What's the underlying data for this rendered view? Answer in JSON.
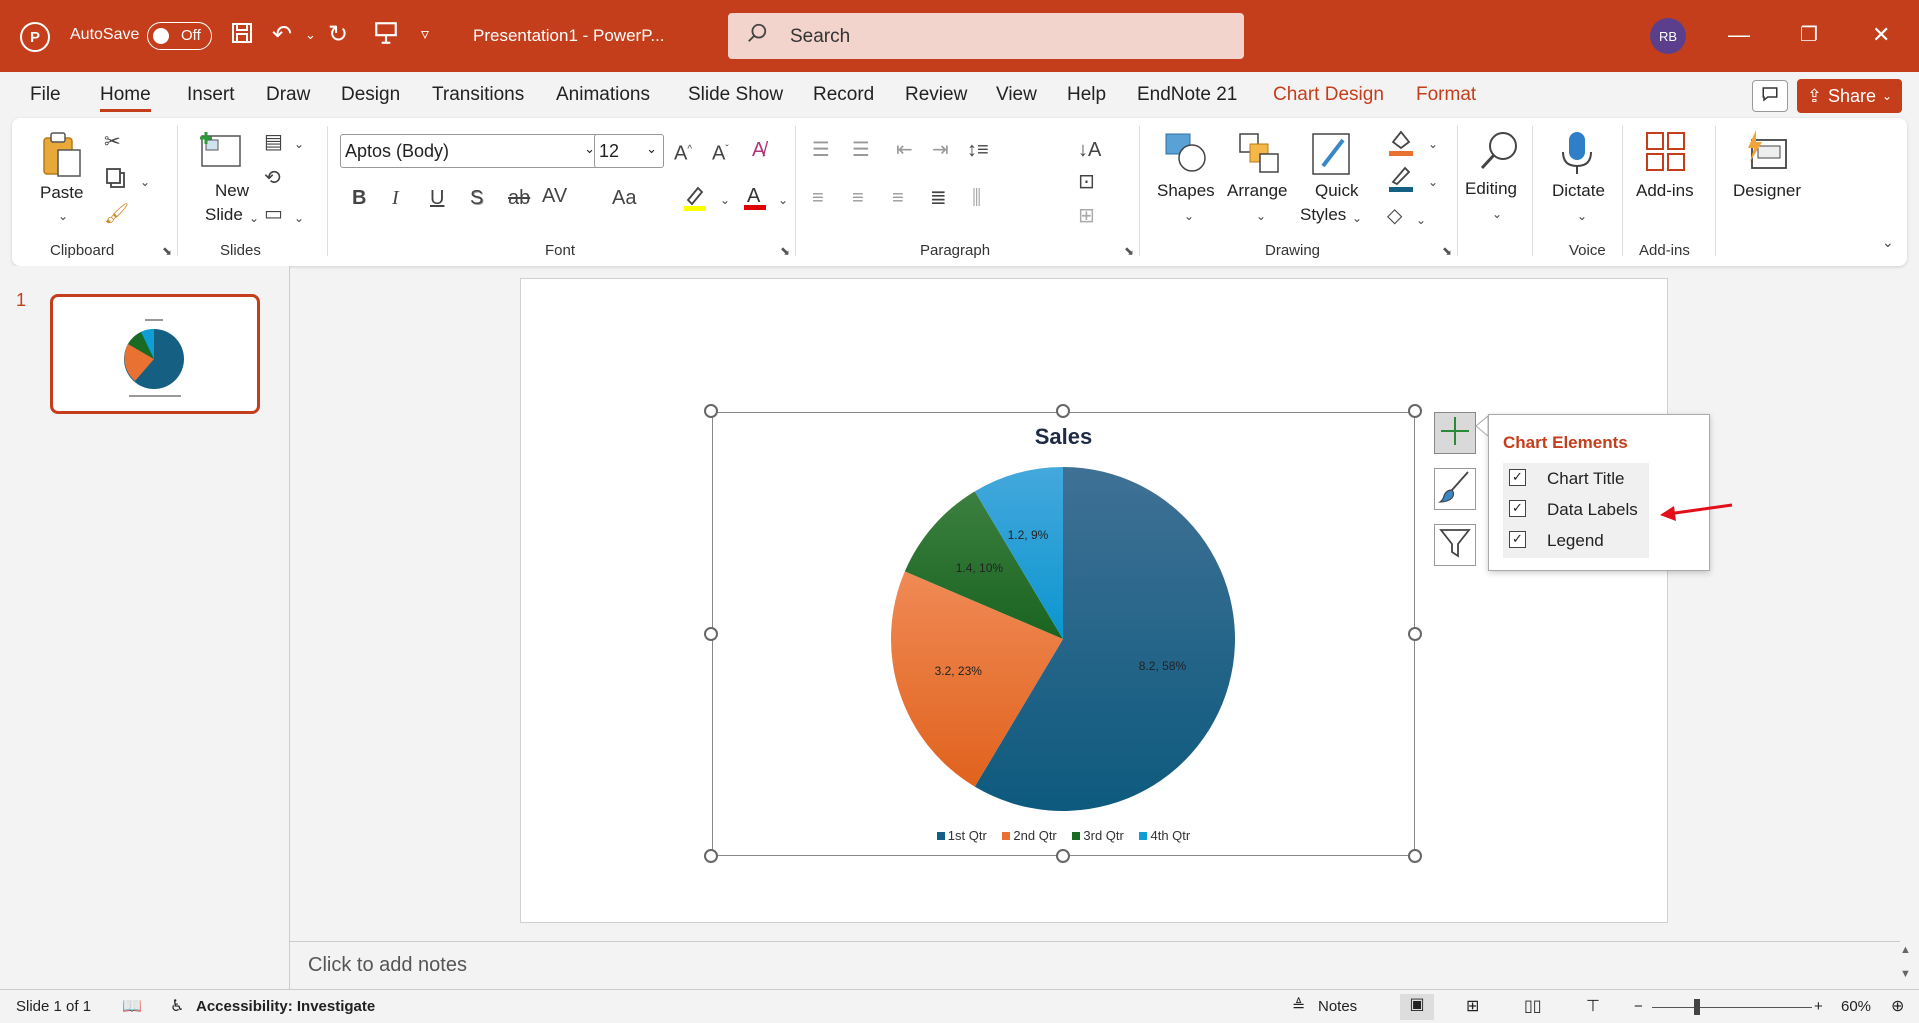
{
  "titlebar": {
    "autosave_label": "AutoSave",
    "autosave_state": "Off",
    "doc_title": "Presentation1  -  PowerP...",
    "search_placeholder": "Search",
    "avatar_initials": "RB"
  },
  "menu": {
    "items": [
      "File",
      "Home",
      "Insert",
      "Draw",
      "Design",
      "Transitions",
      "Animations",
      "Slide Show",
      "Record",
      "Review",
      "View",
      "Help",
      "EndNote 21",
      "Chart Design",
      "Format"
    ],
    "active": "Home",
    "share_label": "Share"
  },
  "ribbon": {
    "clipboard": {
      "label": "Clipboard",
      "paste": "Paste"
    },
    "slides": {
      "label": "Slides",
      "new_slide_1": "New",
      "new_slide_2": "Slide"
    },
    "font": {
      "label": "Font",
      "font_name": "Aptos (Body)",
      "font_size": "12"
    },
    "paragraph": {
      "label": "Paragraph"
    },
    "drawing": {
      "label": "Drawing",
      "shapes": "Shapes",
      "arrange": "Arrange",
      "quick_styles_1": "Quick",
      "quick_styles_2": "Styles"
    },
    "editing": {
      "label": "Editing"
    },
    "voice": {
      "label": "Voice",
      "dictate": "Dictate"
    },
    "addins": {
      "label": "Add-ins",
      "addins_btn": "Add-ins"
    },
    "designer": {
      "label": "Designer"
    }
  },
  "slides_pane": {
    "slide_number": "1"
  },
  "chart_data": {
    "type": "pie",
    "title": "Sales",
    "categories": [
      "1st Qtr",
      "2nd Qtr",
      "3rd Qtr",
      "4th Qtr"
    ],
    "values": [
      8.2,
      3.2,
      1.4,
      1.2
    ],
    "percent_labels": [
      "8.2, 58%",
      "3.2, 23%",
      "1.4, 10%",
      "1.2, 9%"
    ],
    "colors": [
      "#156082",
      "#e97132",
      "#196b24",
      "#0f9ed5"
    ],
    "legend_position": "bottom"
  },
  "chart_elements": {
    "title": "Chart Elements",
    "items": [
      {
        "label": "Chart Title",
        "checked": true
      },
      {
        "label": "Data Labels",
        "checked": true
      },
      {
        "label": "Legend",
        "checked": true
      }
    ]
  },
  "notes": {
    "placeholder": "Click to add notes"
  },
  "statusbar": {
    "slide_info": "Slide 1 of 1",
    "accessibility": "Accessibility: Investigate",
    "notes": "Notes",
    "zoom": "60%"
  },
  "colors": {
    "accent": "#c43e1c"
  }
}
